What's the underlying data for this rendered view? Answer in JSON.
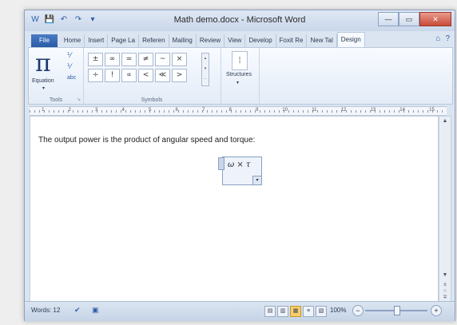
{
  "window": {
    "title": "Math demo.docx - Microsoft Word",
    "qat": [
      "W",
      "💾",
      "↶",
      "↷",
      "▾"
    ],
    "controls": {
      "minimize": "—",
      "maximize": "▭",
      "close": "✕"
    }
  },
  "tabs": [
    {
      "label": "File",
      "kind": "file"
    },
    {
      "label": "Home"
    },
    {
      "label": "Insert"
    },
    {
      "label": "Page La"
    },
    {
      "label": "Referen"
    },
    {
      "label": "Mailing"
    },
    {
      "label": "Review"
    },
    {
      "label": "View"
    },
    {
      "label": "Develop"
    },
    {
      "label": "Foxit Re"
    },
    {
      "label": "New Tal"
    },
    {
      "label": "Design",
      "active": true
    }
  ],
  "tab_icons": [
    "⌂",
    "?"
  ],
  "ribbon": {
    "tools": {
      "equation_symbol": "π",
      "equation_label": "Equation",
      "group_label": "Tools",
      "small_icons": [
        "⅟",
        "⅟",
        "abc"
      ]
    },
    "symbols": {
      "group_label": "Symbols",
      "buttons": [
        "±",
        "∞",
        "=",
        "≠",
        "~",
        "×",
        "÷",
        "!",
        "∝",
        "<",
        "≪",
        ">"
      ],
      "scroll": [
        "▴",
        "▾",
        "⋯"
      ]
    },
    "structures": {
      "icon": "⁞",
      "label": "Structures",
      "arrow": "▾"
    }
  },
  "ruler": {
    "numbers": [
      "1",
      "2",
      "3",
      "4",
      "5",
      "6",
      "7",
      "8",
      "9",
      "10",
      "11",
      "12",
      "13",
      "14",
      "15"
    ]
  },
  "document": {
    "text": "The output power is the product of angular speed and torque:",
    "equation": "ω × τ",
    "equation_menu": "▾"
  },
  "scrollbar": {
    "up": "▲",
    "down": "▼",
    "nav": [
      "±",
      "○",
      "∓"
    ]
  },
  "statusbar": {
    "words": "Words: 12",
    "icons": [
      "✔",
      "▣"
    ],
    "views": [
      "▤",
      "▥",
      "▦",
      "≡",
      "▧"
    ],
    "active_view": 2,
    "zoom": "100%",
    "zoom_minus": "−",
    "zoom_plus": "+",
    "zoom_level": 0.5
  },
  "colors": {
    "accent": "#2a5ba6",
    "ribbon": "#e4ecf7",
    "active_view": "#f6cf6a"
  }
}
